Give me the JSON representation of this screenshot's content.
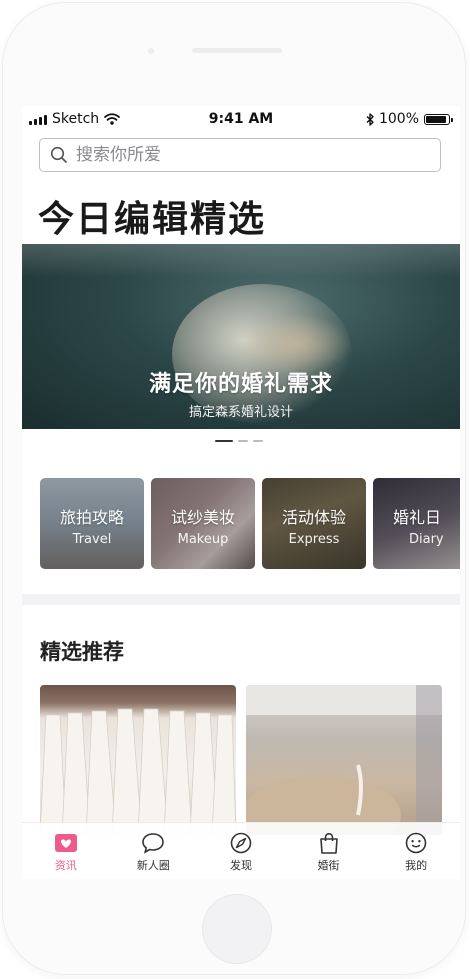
{
  "status_bar": {
    "carrier": "Sketch",
    "time": "9:41 AM",
    "battery": "100%"
  },
  "search": {
    "placeholder": "搜索你所爱"
  },
  "page_title": "今日编辑精选",
  "hero": {
    "title": "满足你的婚礼需求",
    "subtitle": "搞定森系婚礼设计"
  },
  "carousel": {
    "active_index": 0,
    "count": 3
  },
  "categories": [
    {
      "zh": "旅拍攻略",
      "en": "Travel"
    },
    {
      "zh": "试纱美妆",
      "en": "Makeup"
    },
    {
      "zh": "活动体验",
      "en": "Express"
    },
    {
      "zh": "婚礼日",
      "en": "Diary"
    }
  ],
  "recommend": {
    "title": "精选推荐"
  },
  "tabs": [
    {
      "label": "资讯",
      "icon": "news-icon",
      "active": true
    },
    {
      "label": "新人圈",
      "icon": "chat-bubble-icon",
      "active": false
    },
    {
      "label": "发现",
      "icon": "compass-icon",
      "active": false
    },
    {
      "label": "婚街",
      "icon": "shopping-bag-icon",
      "active": false
    },
    {
      "label": "我的",
      "icon": "smiley-face-icon",
      "active": false
    }
  ],
  "colors": {
    "accent": "#ee5a8a",
    "text": "#222222",
    "divider": "#f2f2f4",
    "hero_bg": "#2c4748"
  }
}
